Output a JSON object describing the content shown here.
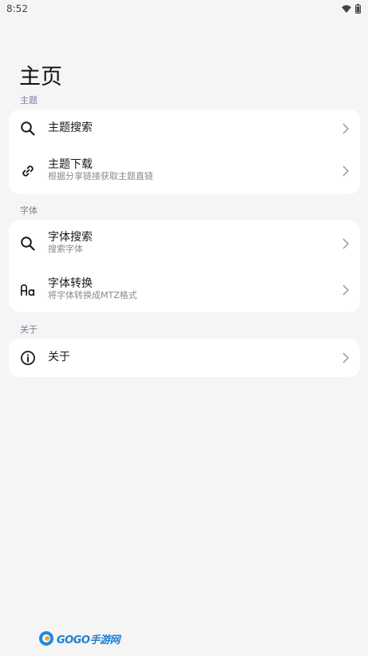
{
  "status_bar": {
    "time": "8:52"
  },
  "page": {
    "title": "主页"
  },
  "sections": [
    {
      "label": "主题",
      "items": [
        {
          "title": "主题搜索",
          "subtitle": "",
          "icon": "search-icon"
        },
        {
          "title": "主题下载",
          "subtitle": "根据分享链接获取主题直链",
          "icon": "link-icon"
        }
      ]
    },
    {
      "label": "字体",
      "items": [
        {
          "title": "字体搜索",
          "subtitle": "搜索字体",
          "icon": "search-icon"
        },
        {
          "title": "字体转换",
          "subtitle": "将字体转换成MTZ格式",
          "icon": "font-icon"
        }
      ]
    },
    {
      "label": "关于",
      "items": [
        {
          "title": "关于",
          "subtitle": "",
          "icon": "info-icon"
        }
      ]
    }
  ],
  "watermark": {
    "text": "GOGO手游网"
  },
  "colors": {
    "background": "#f5f5f5",
    "card": "#ffffff",
    "section_label": "#7a7f9a"
  }
}
